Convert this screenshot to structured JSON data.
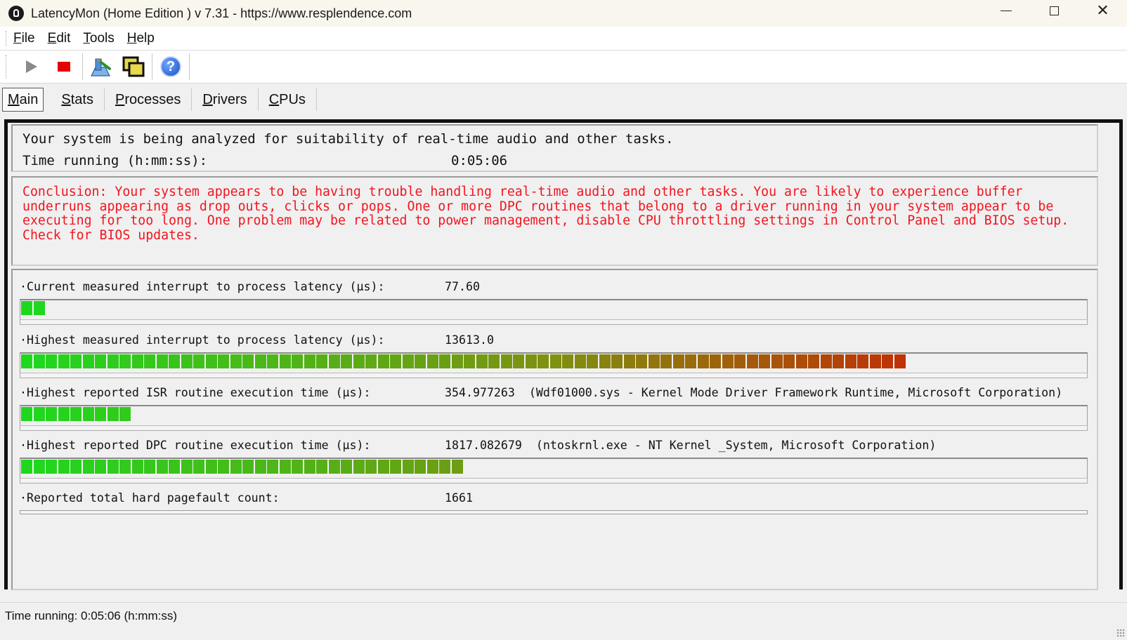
{
  "window": {
    "title": "LatencyMon  (Home Edition )  v 7.31 - https://www.resplendence.com",
    "minimize": "—",
    "maximize": "□",
    "close": "✕"
  },
  "menu": [
    {
      "u": "F",
      "rest": "ile"
    },
    {
      "u": "E",
      "rest": "dit"
    },
    {
      "u": "T",
      "rest": "ools"
    },
    {
      "u": "H",
      "rest": "elp"
    }
  ],
  "toolbar": {
    "buttons": [
      "play-icon",
      "stop-icon",
      "report-icon",
      "copy-windows-icon",
      "help-icon"
    ],
    "help_glyph": "?"
  },
  "tabs": [
    {
      "u": "M",
      "rest": "ain",
      "active": true
    },
    {
      "u": "S",
      "rest": "tats",
      "active": false
    },
    {
      "u": "P",
      "rest": "rocesses",
      "active": false
    },
    {
      "u": "D",
      "rest": "rivers",
      "active": false
    },
    {
      "u": "C",
      "rest": "PUs",
      "active": false
    }
  ],
  "main": {
    "analysis_line": "Your system is being analyzed for suitability of real-time audio and other tasks.",
    "time_label": "Time running (h:mm:ss):",
    "time_value": "0:05:06",
    "conclusion": "Conclusion: Your system appears to be having trouble handling real-time audio and other tasks. You are likely to experience buffer underruns appearing as drop outs, clicks or pops. One or more DPC routines that belong to a driver running in your system appear to be executing for too long. One problem may be related to power management, disable CPU throttling settings in Control Panel and BIOS setup. Check for BIOS updates.",
    "metrics": [
      {
        "label": "·Current measured interrupt to process latency (µs):",
        "value": "77.60",
        "segments": 2
      },
      {
        "label": "·Highest measured interrupt to process latency (µs):",
        "value": "13613.0",
        "segments": 72
      },
      {
        "label": "·Highest reported ISR routine execution time (µs):",
        "value": "354.977263  (Wdf01000.sys - Kernel Mode Driver Framework Runtime, Microsoft Corporation)",
        "segments": 9
      },
      {
        "label": "·Highest reported DPC routine execution time (µs):",
        "value": "1817.082679  (ntoskrnl.exe - NT Kernel _System, Microsoft Corporation)",
        "segments": 36
      },
      {
        "label": "·Reported total hard pagefault count:",
        "value": "1661"
      }
    ],
    "bar_colors": {
      "start": "#1ed81e",
      "end": "#e00000",
      "max_segments": 87
    }
  },
  "statusbar": {
    "text": "Time running: 0:05:06  (h:mm:ss)"
  }
}
